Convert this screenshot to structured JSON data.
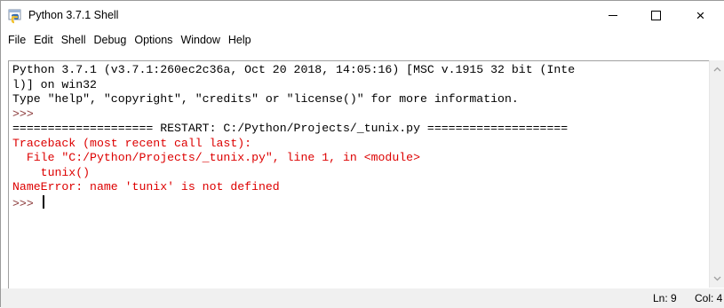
{
  "window": {
    "title": "Python 3.7.1 Shell",
    "icon": "python-idle-icon",
    "controls": {
      "minimize": "minimize-icon",
      "maximize": "maximize-icon",
      "close": "×"
    }
  },
  "menu": [
    {
      "label": "File"
    },
    {
      "label": "Edit"
    },
    {
      "label": "Shell"
    },
    {
      "label": "Debug"
    },
    {
      "label": "Options"
    },
    {
      "label": "Window"
    },
    {
      "label": "Help"
    }
  ],
  "shell": {
    "lines": [
      {
        "text": "Python 3.7.1 (v3.7.1:260ec2c36a, Oct 20 2018, 14:05:16) [MSC v.1915 32 bit (Inte",
        "color": "black"
      },
      {
        "text": "l)] on win32",
        "color": "black"
      },
      {
        "text": "Type \"help\", \"copyright\", \"credits\" or \"license()\" for more information.",
        "color": "black"
      },
      {
        "text": ">>> ",
        "color": "prompt"
      },
      {
        "text": "==================== RESTART: C:/Python/Projects/_tunix.py ====================",
        "color": "black"
      },
      {
        "text": "Traceback (most recent call last):",
        "color": "red"
      },
      {
        "text": "  File \"C:/Python/Projects/_tunix.py\", line 1, in <module>",
        "color": "red"
      },
      {
        "text": "    tunix()",
        "color": "red"
      },
      {
        "text": "NameError: name 'tunix' is not defined",
        "color": "red"
      }
    ],
    "prompt": ">>> "
  },
  "status": {
    "line": "Ln: 9",
    "col": "Col: 4"
  },
  "colors": {
    "error": "#dd0000",
    "prompt": "#8b3a3a",
    "text": "#000000"
  }
}
